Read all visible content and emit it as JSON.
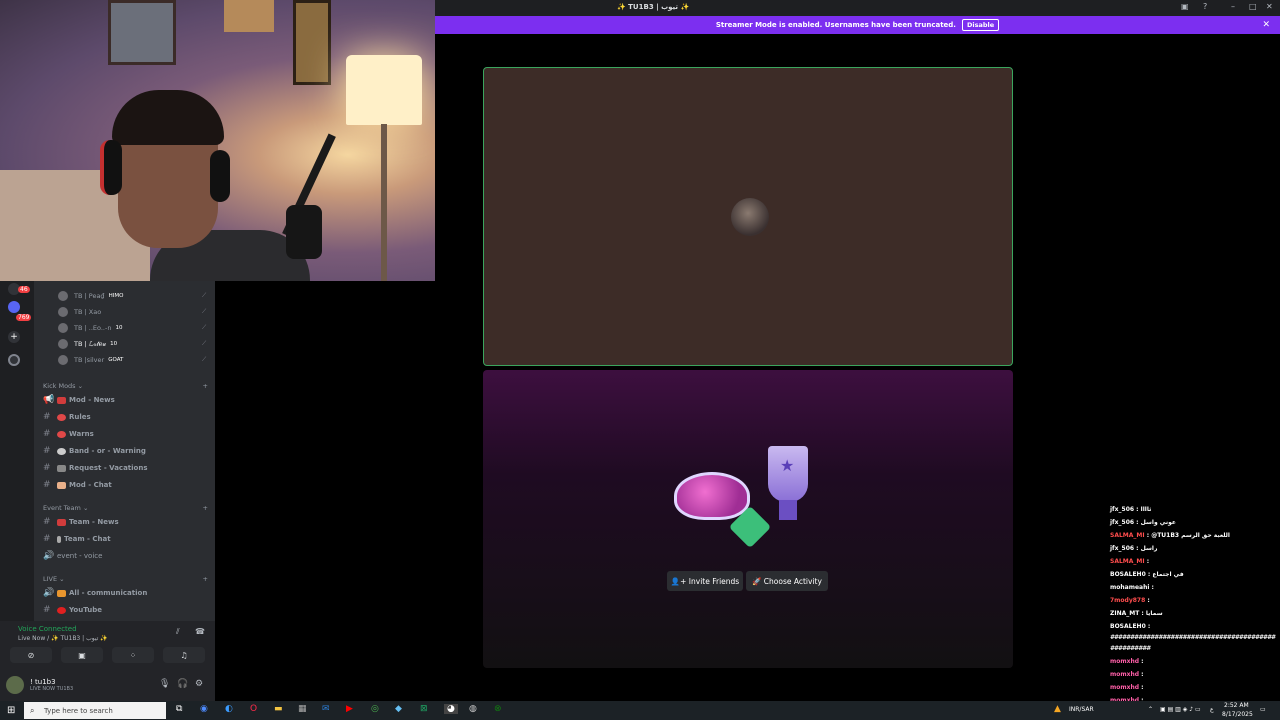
{
  "window": {
    "title": "✨ TU1B3 | تيوب ✨"
  },
  "streamer_banner": {
    "text": "Streamer Mode is enabled. Usernames have been truncated.",
    "disable_label": "Disable",
    "close_icon": "✕"
  },
  "guilds": {
    "badge1": "46",
    "badge2": "769"
  },
  "members": [
    {
      "name": "TB | Pea₫",
      "tag": "HIMO"
    },
    {
      "name": "TB | Xao",
      "tag": ""
    },
    {
      "name": "TB | ..Eo..-n",
      "tag": "10"
    },
    {
      "name": "TB | ℒℴ𝓉ℯ𝓊",
      "tag": "10"
    },
    {
      "name": "TB |silver",
      "tag": "GOAT"
    }
  ],
  "categories": {
    "kick_mods": "Kick Mods",
    "event_team": "Event Team",
    "live": "LIVE"
  },
  "channels": {
    "mod_news": "Mod - News",
    "rules": "Rules",
    "warns": "Warns",
    "band_warning": "Band - or - Warning",
    "request_vacations": "Request - Vacations",
    "mod_chat": "Mod - Chat",
    "team_news": "Team - News",
    "team_chat": "Team - Chat",
    "event_voice": "event - voice",
    "all_comm": "All - communication",
    "youtube": "YouTube"
  },
  "voice": {
    "status": "Voice Connected",
    "channel": "Live Now / ✨ TU1B3 | تيوب ✨"
  },
  "user": {
    "name": "! tu1b3",
    "status": "LIVE NOW TU1B3"
  },
  "activity": {
    "invite_label": "Invite Friends",
    "choose_label": "Choose Activity"
  },
  "chat": [
    {
      "name": "jfx_506",
      "msg": ": ثاااا",
      "color": "white"
    },
    {
      "name": "jfx_506",
      "msg": ": عوني واسل",
      "color": "white"
    },
    {
      "name": "SALMA_MI",
      "msg": ": @TU1B3 اللعبة حق الرسم",
      "color": "red"
    },
    {
      "name": "jfx_506",
      "msg": ": راسل",
      "color": "white"
    },
    {
      "name": "SALMA_MI",
      "msg": ":",
      "color": "red"
    },
    {
      "name": "BOSALEH0",
      "msg": ": في اجتماع",
      "color": "white"
    },
    {
      "name": "mohameahi",
      "msg": ":",
      "color": "white"
    },
    {
      "name": "7mody878",
      "msg": ":",
      "color": "red"
    },
    {
      "name": "ZINA_MT",
      "msg": ": سمايا",
      "color": "white"
    },
    {
      "name": "BOSALEH0",
      "msg": ":",
      "color": "white"
    },
    {
      "name": "",
      "msg": "#########################################",
      "color": "white"
    },
    {
      "name": "",
      "msg": "##########",
      "color": "white"
    },
    {
      "name": "momxhd",
      "msg": ":",
      "color": "mag"
    },
    {
      "name": "momxhd",
      "msg": ":",
      "color": "mag"
    },
    {
      "name": "momxhd",
      "msg": ":",
      "color": "mag"
    },
    {
      "name": "momxhd",
      "msg": ":",
      "color": "mag"
    }
  ],
  "taskbar": {
    "search_placeholder": "Type here to search",
    "currency": "INR/SAR",
    "time": "2:52 AM",
    "date": "8/17/2025"
  }
}
